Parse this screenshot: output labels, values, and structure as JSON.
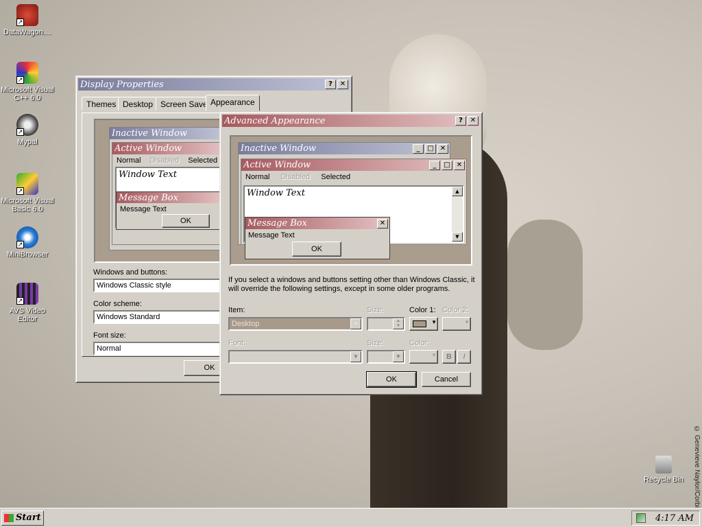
{
  "desktop": {
    "icons": [
      {
        "label": "DataWagon...."
      },
      {
        "label": "Microsoft Visual C++ 6.0"
      },
      {
        "label": "Mypal"
      },
      {
        "label": "Microsoft Visual Basic 6.0"
      },
      {
        "label": "MiniBrowser"
      },
      {
        "label": "AVS Video Editor"
      },
      {
        "label": "Recycle Bin"
      }
    ],
    "copyright": "© Genevieve Naylor/Corbis"
  },
  "display_properties": {
    "title": "Display Properties",
    "tabs": [
      "Themes",
      "Desktop",
      "Screen Saver",
      "Appearance"
    ],
    "preview": {
      "inactive_title": "Inactive Window",
      "active_title": "Active Window",
      "menu_normal": "Normal",
      "menu_disabled": "Disabled",
      "menu_selected": "Selected",
      "window_text": "Window Text",
      "msgbox_title": "Message Box",
      "msgbox_text": "Message Text",
      "ok": "OK"
    },
    "windows_buttons_label": "Windows and buttons:",
    "windows_buttons_value": "Windows Classic style",
    "color_scheme_label": "Color scheme:",
    "color_scheme_value": "Windows Standard",
    "font_size_label": "Font size:",
    "font_size_value": "Normal",
    "ok": "OK"
  },
  "advanced": {
    "title": "Advanced Appearance",
    "preview": {
      "inactive_title": "Inactive Window",
      "active_title": "Active Window",
      "menu_normal": "Normal",
      "menu_disabled": "Disabled",
      "menu_selected": "Selected",
      "window_text": "Window Text",
      "msgbox_title": "Message Box",
      "msgbox_text": "Message Text",
      "ok": "OK"
    },
    "info": "If you select a windows and buttons setting other than Windows Classic, it will override the following settings, except in some older programs.",
    "item_label": "Item:",
    "item_value": "Desktop",
    "size_label": "Size:",
    "color1_label": "Color 1:",
    "color2_label": "Color 2:",
    "font_label": "Font:",
    "font_size_label": "Size:",
    "font_color_label": "Color:",
    "bold": "B",
    "italic": "I",
    "ok": "OK",
    "cancel": "Cancel",
    "desktop_color": "#a89a8a"
  },
  "taskbar": {
    "start": "Start",
    "clock": "4:17 AM"
  }
}
